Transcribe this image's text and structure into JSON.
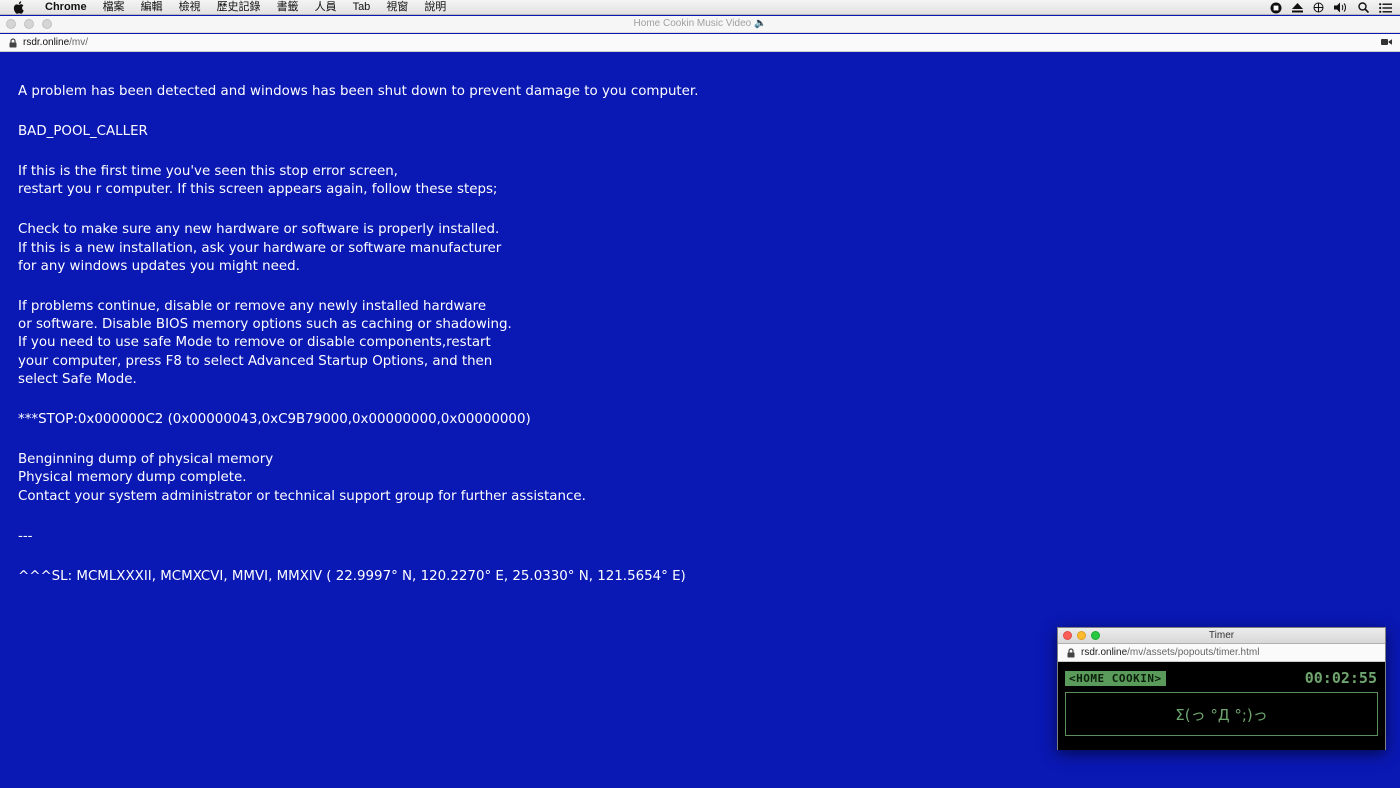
{
  "menubar": {
    "app_name": "Chrome",
    "items": [
      "檔案",
      "編輯",
      "檢視",
      "歷史記錄",
      "書籤",
      "人員",
      "Tab",
      "視窗",
      "說明"
    ]
  },
  "browser": {
    "window_title": "Home Cookin Music Video 🔈",
    "url_host": "rsdr.online",
    "url_path": "/mv/"
  },
  "bsod": {
    "background_color": "#0a18b4",
    "blocks": [
      [
        "A problem has been detected and windows has been shut down to prevent damage to you computer."
      ],
      [
        "BAD_POOL_CALLER"
      ],
      [
        "If this is the first time you've seen this stop error screen,",
        "restart you r computer. If this screen appears again, follow these steps;"
      ],
      [
        "Check to make sure any new hardware or software is properly installed.",
        "If this is a new installation, ask your hardware or software manufacturer",
        "for any windows updates you might need."
      ],
      [
        "If problems continue, disable or remove any newly installed hardware",
        "or software. Disable BIOS memory options such as caching or shadowing.",
        "If you need to use safe Mode to remove or disable components,restart",
        "your computer, press F8 to select Advanced Startup Options, and then",
        "select Safe Mode."
      ],
      [
        "***STOP:0x000000C2 (0x00000043,0xC9B79000,0x00000000,0x00000000)"
      ],
      [
        "Benginning dump of physical memory",
        "Physical memory dump complete.",
        "Contact your system administrator or technical support group for further assistance."
      ],
      [
        "---"
      ],
      [
        "^^^SL: MCMLXXXII, MCMXCVI, MMVI, MMXIV ( 22.9997° N, 120.2270° E, 25.0330° N, 121.5654° E)"
      ]
    ]
  },
  "timer_window": {
    "title": "Timer",
    "url_host": "rsdr.online",
    "url_path": "/mv/assets/popouts/timer.html",
    "brand_label": "<HOME COOKIN>",
    "time": "00:02:55",
    "emoticon": "Σ(っ °Д °;)っ",
    "accent_color": "#6ea56e"
  }
}
